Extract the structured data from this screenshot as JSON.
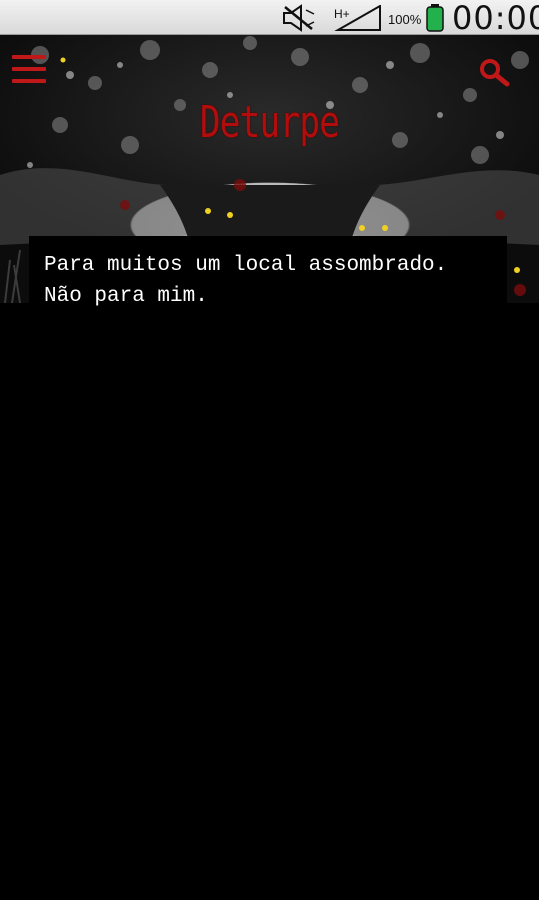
{
  "status_bar": {
    "battery_percent": "100%",
    "time": "00:00",
    "network_type": "H+",
    "icons": [
      "mute-icon",
      "signal-icon",
      "battery-icon"
    ],
    "battery_color": "#23b14d"
  },
  "header": {
    "title": "Deturpe",
    "menu_icon": "hamburger-menu-icon",
    "search_icon": "search-icon",
    "accent_color": "#b10d0d"
  },
  "caption": {
    "line1": "Para muitos um local assombrado.",
    "line2": "Não para mim."
  }
}
